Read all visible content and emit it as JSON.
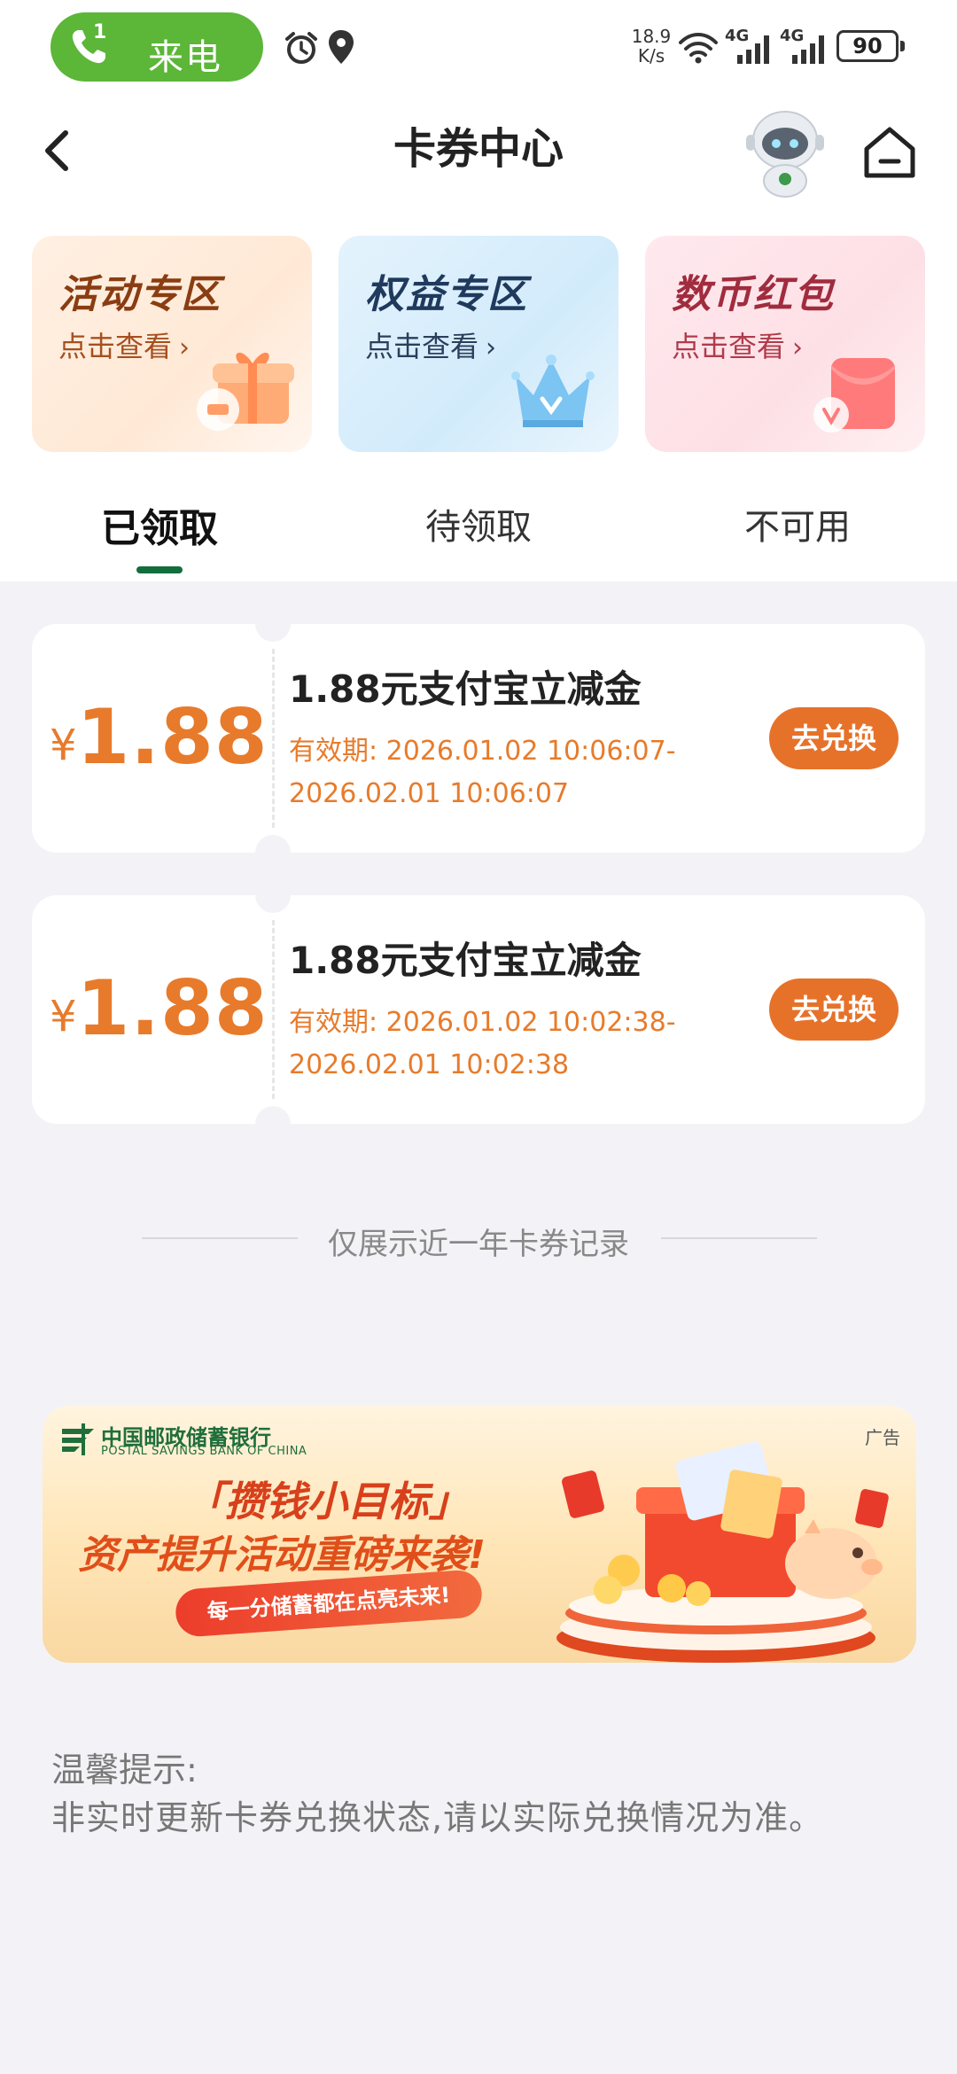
{
  "status_bar": {
    "call_count": "1",
    "call_label": "来电",
    "net_speed_value": "18.9",
    "net_speed_unit": "K/s",
    "signal_1_label": "4G",
    "signal_2_label": "4G",
    "battery": "90"
  },
  "nav": {
    "title": "卡券中心"
  },
  "promo_tiles": [
    {
      "title": "活动专区",
      "sub": "点击查看",
      "chev": "›"
    },
    {
      "title": "权益专区",
      "sub": "点击查看",
      "chev": "›"
    },
    {
      "title": "数币红包",
      "sub": "点击查看",
      "chev": "›"
    }
  ],
  "tabs": [
    {
      "label": "已领取",
      "active": true
    },
    {
      "label": "待领取",
      "active": false
    },
    {
      "label": "不可用",
      "active": false
    }
  ],
  "coupons": [
    {
      "currency": "¥",
      "amount": "1.88",
      "title": "1.88元支付宝立减金",
      "valid_label": "有效期:",
      "valid_start": "2026.01.02 10:06:07-",
      "valid_end": "2026.02.01 10:06:07",
      "button": "去兑换"
    },
    {
      "currency": "¥",
      "amount": "1.88",
      "title": "1.88元支付宝立减金",
      "valid_label": "有效期:",
      "valid_start": "2026.01.02 10:02:38-",
      "valid_end": "2026.02.01 10:02:38",
      "button": "去兑换"
    }
  ],
  "record_notice": "仅展示近一年卡券记录",
  "banner": {
    "bank_name": "中国邮政储蓄银行",
    "bank_name_en": "POSTAL SAVINGS BANK OF CHINA",
    "ad_tag": "广告",
    "headline_1": "「攒钱小目标」",
    "headline_2": "资产提升活动重磅来袭!",
    "ribbon": "每一分储蓄都在点亮未来!"
  },
  "tips": {
    "title": "温馨提示:",
    "body": "非实时更新卡券兑换状态,请以实际兑换情况为准。"
  },
  "colors": {
    "accent_green": "#136e3c",
    "call_green": "#5cb638",
    "coupon_orange": "#e77b2b",
    "button_orange": "#e6722a",
    "page_bg": "#f3f3f7"
  }
}
